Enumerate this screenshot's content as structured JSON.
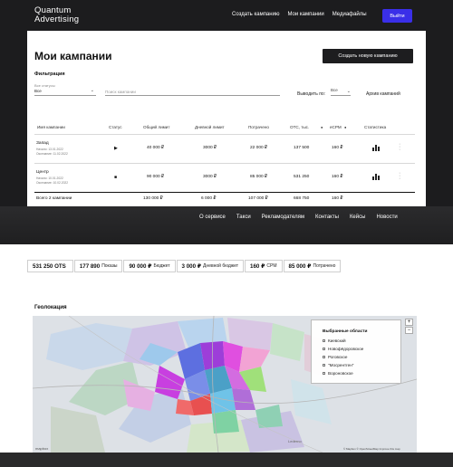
{
  "header": {
    "logo_line1": "Quantum",
    "logo_line2": "Advertising",
    "nav": [
      "Создать кампанию",
      "Мои кампании",
      "Медиафайлы"
    ],
    "exit_label": "Выйти"
  },
  "page": {
    "title": "Мои кампании",
    "new_campaign_label": "Создать новую кампанию",
    "filter_title": "Фильтрация",
    "status_label": "Все статусы",
    "status_value": "Все",
    "search_placeholder": "Поиск кампании",
    "show_label": "Выводить по:",
    "show_value": "Все",
    "archive_label": "Архив кампаний"
  },
  "table": {
    "headers": [
      "Имя кампании",
      "Статус",
      "Общий лимит",
      "Дневной лимит",
      "Потрачено",
      "OTC, тыс.",
      "eCPM",
      "Статистика"
    ],
    "rows": [
      {
        "name": "Запад",
        "start": "Начало: 13.01.2022",
        "end": "Окончание: 11.02.2022",
        "status_icon": "play-icon",
        "total_limit": "40 000 ₽",
        "daily_limit": "3000 ₽",
        "spent": "22 000 ₽",
        "otc": "137 500",
        "ecpm": "160 ₽"
      },
      {
        "name": "Центр",
        "start": "Начало: 10.01.2022",
        "end": "Окончание: 10.02.2022",
        "status_icon": "stop-icon",
        "total_limit": "90 000 ₽",
        "daily_limit": "3000 ₽",
        "spent": "85 000 ₽",
        "otc": "531 250",
        "ecpm": "160 ₽"
      }
    ],
    "total": {
      "label": "Всего 2 кампании",
      "total_limit": "130 000 ₽",
      "daily_limit": "6 000 ₽",
      "spent": "107 000 ₽",
      "otc": "668 750",
      "ecpm": "160 ₽"
    }
  },
  "footer_nav": [
    "О сервисе",
    "Такси",
    "Рекламодателям",
    "Контакты",
    "Кейсы",
    "Новости"
  ],
  "stats": [
    {
      "value": "531 250 OTS",
      "label": ""
    },
    {
      "value": "177 890",
      "label": "Показы"
    },
    {
      "value": "90 000 ₽",
      "label": "Бюджет"
    },
    {
      "value": "3 000 ₽",
      "label": "Дневной бюджет"
    },
    {
      "value": "160 ₽",
      "label": "CPM"
    },
    {
      "value": "85 000 ₽",
      "label": "Потрачено"
    }
  ],
  "geo": {
    "title": "Геолокация",
    "legend_title": "Выбранные области",
    "legend_items": [
      "Киевский",
      "Новофёдоровское",
      "Роговское",
      "\"Мосрентген\"",
      "Вороновское"
    ],
    "zoom_in": "+",
    "zoom_out": "−",
    "attribution": "© Mapbox © OpenStreetMap Improve this map",
    "map_logo": "mapbox",
    "places": [
      "Lederno"
    ]
  },
  "colors": {
    "accent": "#3a2fe8",
    "dark_button": "#1d1d1f"
  }
}
